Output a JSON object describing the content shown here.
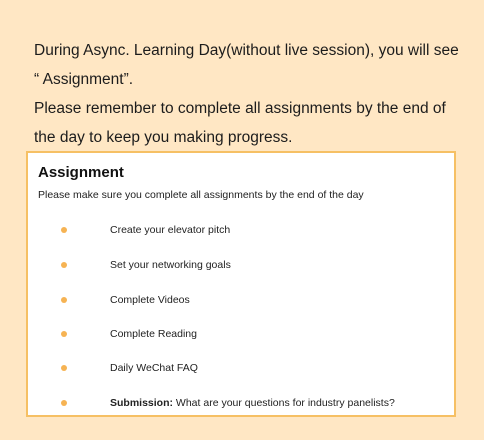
{
  "intro": {
    "line1": "During Async. Learning Day(without live session), you will see “ Assignment”.",
    "line2": "Please remember to complete all assignments by the end of the day to keep you making progress."
  },
  "card": {
    "title": "Assignment",
    "subtitle": "Please make sure you complete all assignments by the end of the day",
    "items": [
      {
        "label": "Create your elevator pitch"
      },
      {
        "label": "Set your networking goals"
      },
      {
        "label": "Complete Videos"
      },
      {
        "label": "Complete Reading"
      },
      {
        "label": "Daily WeChat FAQ"
      },
      {
        "prefix": "Submission:",
        "label": " What are your questions for industry panelists?"
      }
    ],
    "bullet_color": "#f6b353",
    "border_color": "#f6c064"
  },
  "colors": {
    "background": "#ffe7c4"
  }
}
